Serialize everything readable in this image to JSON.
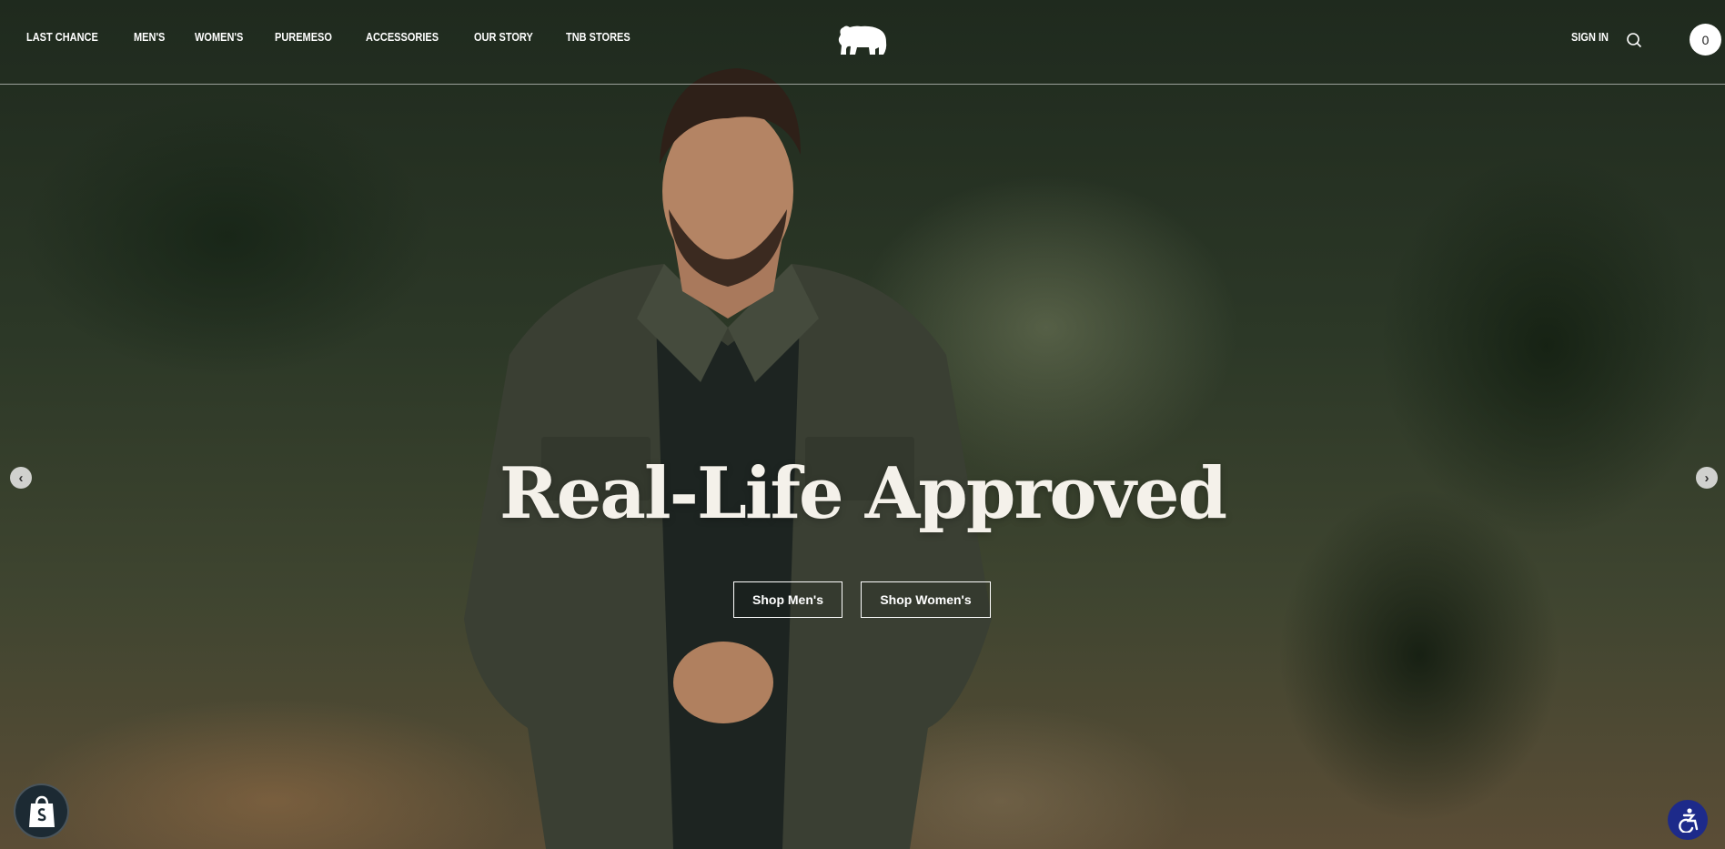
{
  "header": {
    "nav": [
      {
        "label": "LAST CHANCE"
      },
      {
        "label": "MEN'S"
      },
      {
        "label": "WOMEN'S"
      },
      {
        "label": "PUREMESO"
      },
      {
        "label": "ACCESSORIES"
      },
      {
        "label": "OUR STORY"
      },
      {
        "label": "TNB STORES"
      }
    ],
    "logo_icon": "bear-logo-icon",
    "sign_in": "SIGN IN",
    "search_icon": "search-icon",
    "cart_count": "0"
  },
  "hero": {
    "headline": "Real-Life Approved",
    "buttons": {
      "men": "Shop Men's",
      "women": "Shop Women's"
    },
    "prev_icon": "chevron-left-icon",
    "next_icon": "chevron-right-icon"
  },
  "widgets": {
    "shopify_icon": "shopify-bag-icon",
    "accessibility_icon": "accessibility-icon"
  },
  "colors": {
    "text": "#ffffff",
    "headline": "#f4f1ea",
    "accessibility_bg": "#1d2a8a",
    "shopify_bg": "#1c2a33"
  }
}
